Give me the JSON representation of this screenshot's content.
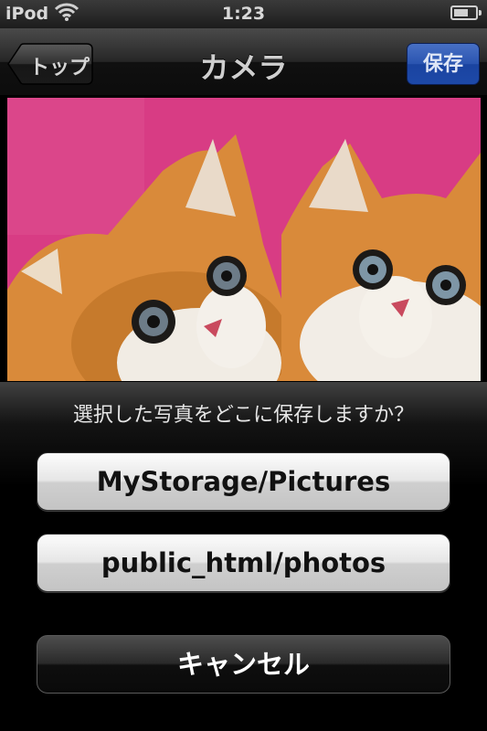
{
  "status_bar": {
    "carrier": "iPod",
    "time": "1:23",
    "battery_level": 0.7,
    "icons": [
      "wifi-icon",
      "battery-icon"
    ]
  },
  "nav_bar": {
    "title": "カメラ",
    "back_label": "トップ",
    "save_label": "保存",
    "save_color": "#2a54b0"
  },
  "photo": {
    "background_color": "#d83c84"
  },
  "action_sheet": {
    "prompt": "選択した写真をどこに保存しますか？",
    "options": [
      {
        "label": "MyStorage/Pictures"
      },
      {
        "label": "public_html/photos"
      }
    ],
    "cancel_label": "キャンセル"
  }
}
